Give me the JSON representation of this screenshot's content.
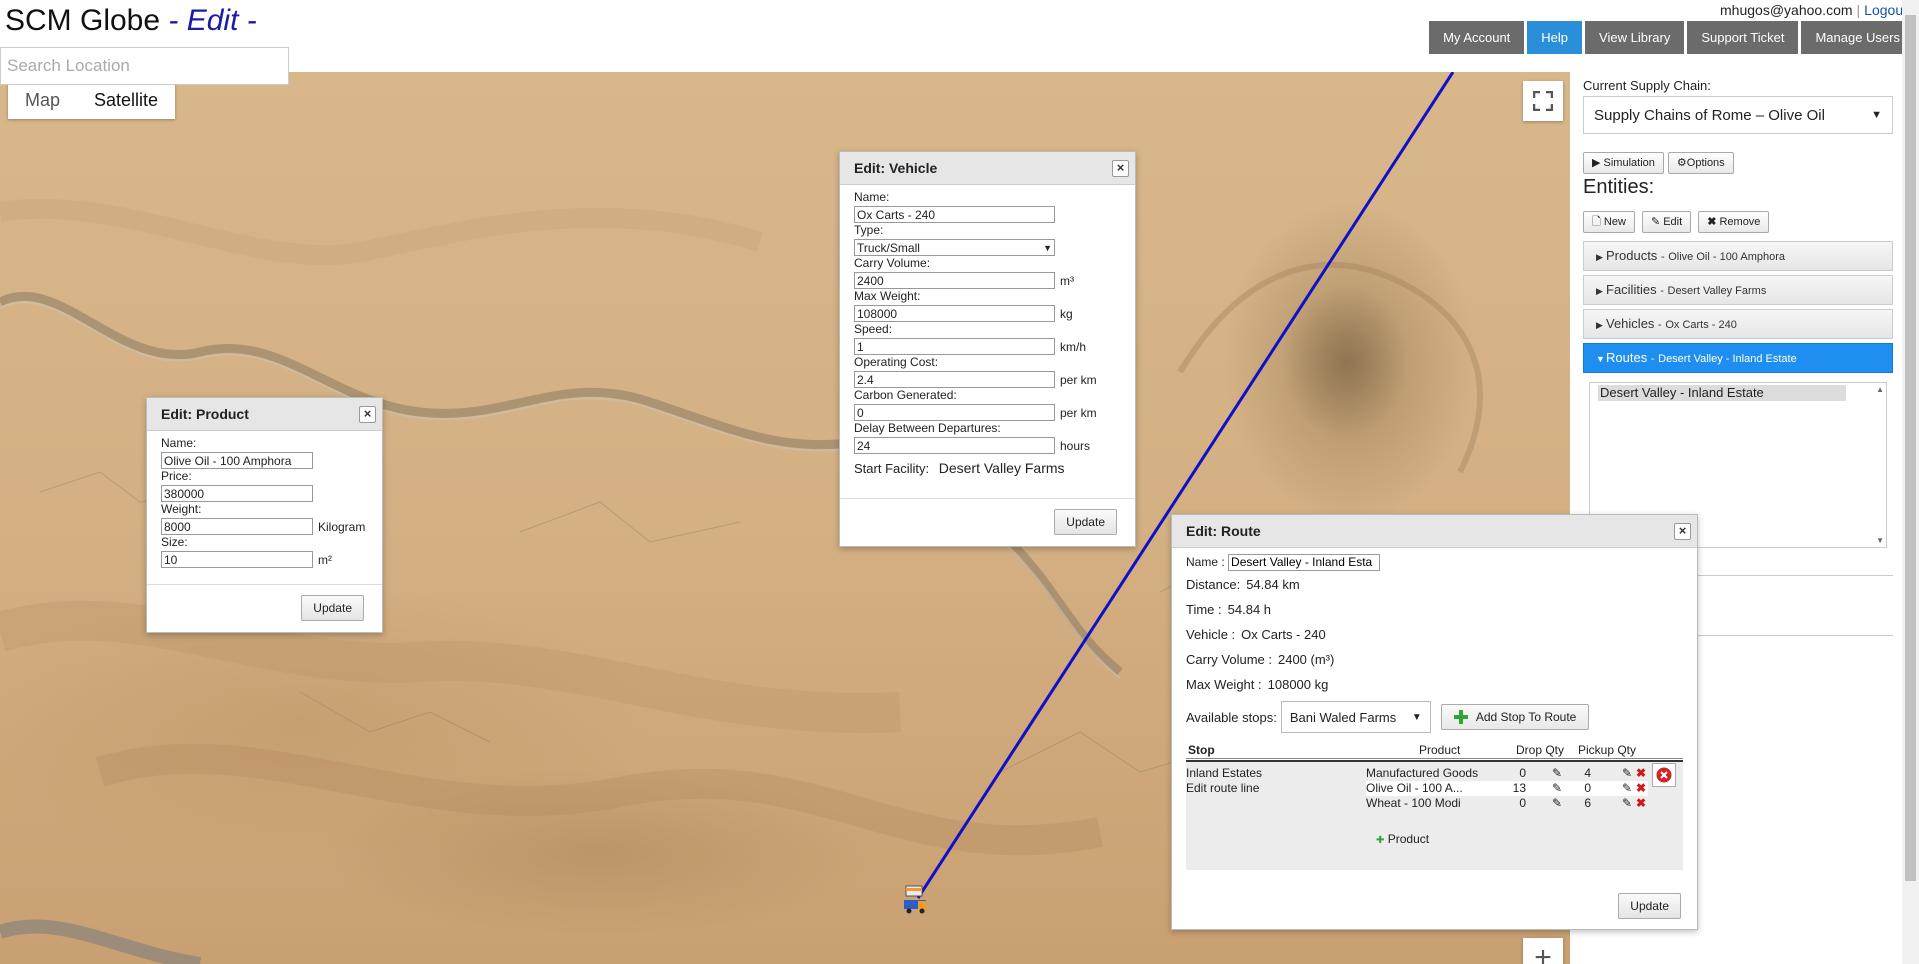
{
  "header": {
    "app_name": "SCM Globe",
    "mode": "- Edit -",
    "user_email": "mhugos@yahoo.com",
    "separator": "|",
    "logout": "Logout",
    "search_placeholder": "Search Location",
    "nav": [
      "My Account",
      "Help",
      "View Library",
      "Support Ticket",
      "Manage Users"
    ]
  },
  "map": {
    "types": [
      "Map",
      "Satellite"
    ],
    "active_type": "Satellite",
    "zoom_in": "+"
  },
  "product_dialog": {
    "title": "Edit: Product",
    "close": "×",
    "fields": [
      {
        "label": "Name:",
        "value": "Olive Oil - 100 Amphora",
        "unit": ""
      },
      {
        "label": "Price:",
        "value": "380000",
        "unit": ""
      },
      {
        "label": "Weight:",
        "value": "8000",
        "unit": "Kilogram"
      },
      {
        "label": "Size:",
        "value": "10",
        "unit": "m²"
      }
    ],
    "update": "Update"
  },
  "vehicle_dialog": {
    "title": "Edit: Vehicle",
    "close": "×",
    "name_label": "Name:",
    "name_value": "Ox Carts - 240",
    "type_label": "Type:",
    "type_value": "Truck/Small",
    "fields": [
      {
        "label": "Carry Volume:",
        "value": "2400",
        "unit": "m³"
      },
      {
        "label": "Max Weight:",
        "value": "108000",
        "unit": "kg"
      },
      {
        "label": "Speed:",
        "value": "1",
        "unit": "km/h"
      },
      {
        "label": "Operating Cost:",
        "value": "2.4",
        "unit": "per km"
      },
      {
        "label": "Carbon Generated:",
        "value": "0",
        "unit": "per km"
      },
      {
        "label": "Delay Between Departures:",
        "value": "24",
        "unit": "hours"
      }
    ],
    "start_label": "Start Facility:",
    "start_value": "Desert Valley Farms",
    "update": "Update"
  },
  "route_dialog": {
    "title": "Edit: Route",
    "close": "×",
    "name_label": "Name :",
    "name_value": "Desert Valley - Inland Esta",
    "lines": [
      {
        "label": "Distance:",
        "value": "54.84 km"
      },
      {
        "label": "Time :",
        "value": "54.84 h"
      },
      {
        "label": "Vehicle :",
        "value": "Ox Carts - 240"
      },
      {
        "label": "Carry Volume :",
        "value": "2400 (m³)"
      },
      {
        "label": "Max Weight :",
        "value": "108000 kg"
      }
    ],
    "stops_label": "Available stops:",
    "stops_value": "Bani Waled Farms",
    "add_stop": "Add Stop To Route",
    "columns": [
      "Stop",
      "Product",
      "Drop Qty",
      "Pickup Qty"
    ],
    "stop_name": "Inland Estates",
    "edit_route_line": "Edit route line",
    "rows": [
      {
        "product": "Manufactured Goods",
        "drop": "0",
        "pickup": "4"
      },
      {
        "product": "Olive Oil - 100 A...",
        "drop": "13",
        "pickup": "0"
      },
      {
        "product": "Wheat - 100 Modi",
        "drop": "0",
        "pickup": "6"
      }
    ],
    "add_product": "Product",
    "update": "Update"
  },
  "panel": {
    "chain_label": "Current Supply Chain:",
    "chain_value": "Supply Chains of Rome – Olive Oil",
    "simulation": "Simulation",
    "options": "Options",
    "entities_title": "Entities:",
    "new": "New",
    "edit": "Edit",
    "remove": "Remove",
    "sections": [
      {
        "name": "Products",
        "sub": "Olive Oil - 100 Amphora"
      },
      {
        "name": "Facilities",
        "sub": "Desert Valley Farms"
      },
      {
        "name": "Vehicles",
        "sub": "Ox Carts - 240"
      },
      {
        "name": "Routes",
        "sub": "Desert Valley - Inland Estate"
      }
    ],
    "separator": "-",
    "routes_list": [
      "Desert Valley - Inland Estate"
    ]
  },
  "colors": {
    "route_line": "#1010c8",
    "accent_blue": "#1e8ff0",
    "nav_gray": "#6b6b6b",
    "help_blue": "#2a8fd8"
  }
}
